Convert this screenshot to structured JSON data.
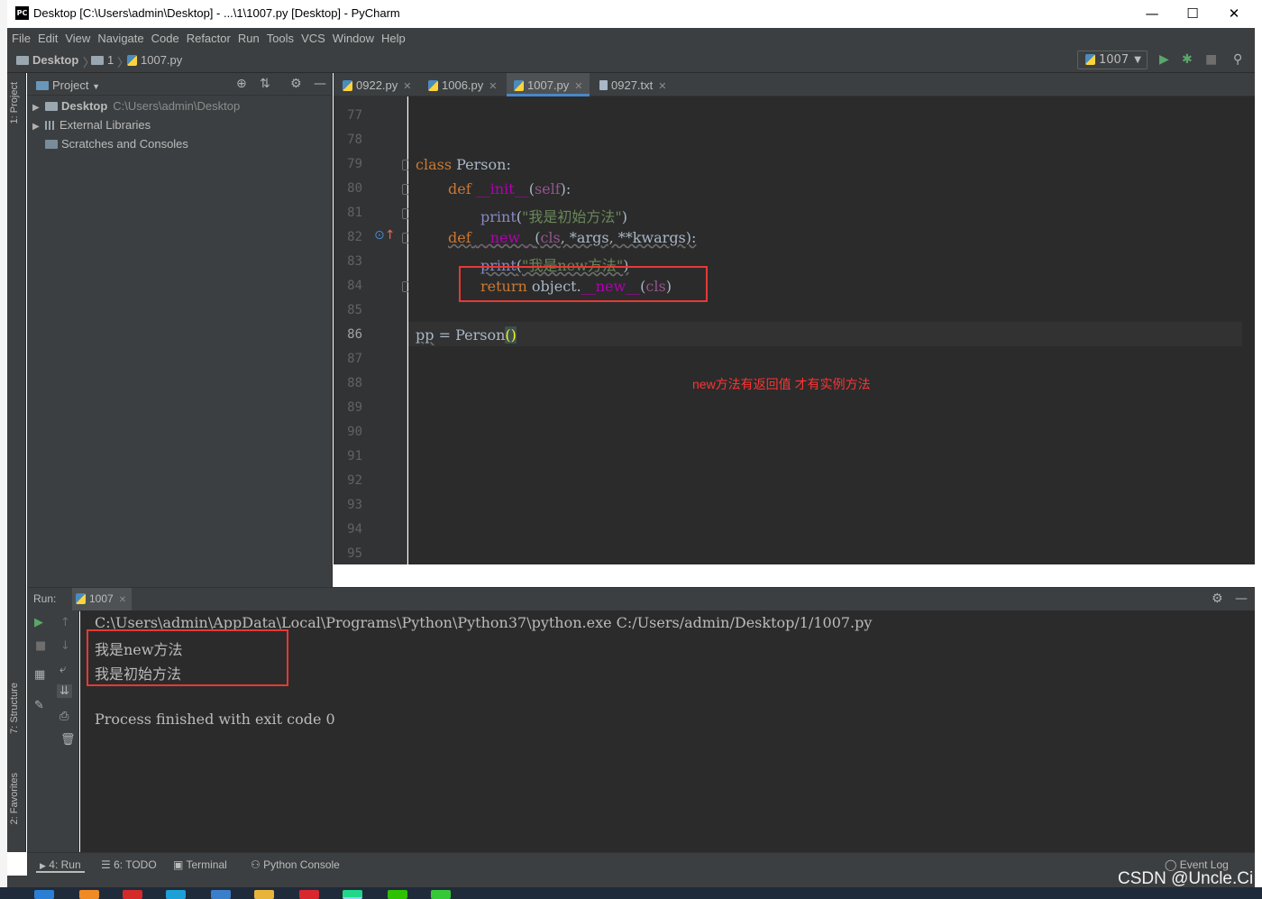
{
  "window": {
    "title": "Desktop [C:\\Users\\admin\\Desktop] - ...\\1\\1007.py [Desktop] - PyCharm",
    "logo": "PC",
    "controls": {
      "minimize": "—",
      "maximize": "☐",
      "close": "✕"
    }
  },
  "menu": [
    "File",
    "Edit",
    "View",
    "Navigate",
    "Code",
    "Refactor",
    "Run",
    "Tools",
    "VCS",
    "Window",
    "Help"
  ],
  "breadcrumb": {
    "root": "Desktop",
    "folder": "1",
    "file": "1007.py"
  },
  "run_config": "1007",
  "left_strip": {
    "project": "1: Project",
    "structure": "7: Structure",
    "favorites": "2: Favorites"
  },
  "project": {
    "title": "Project",
    "tree": [
      {
        "label": "Desktop",
        "path": "C:\\Users\\admin\\Desktop"
      },
      {
        "label": "External Libraries"
      },
      {
        "label": "Scratches and Consoles"
      }
    ]
  },
  "tabs": [
    {
      "label": "0922.py",
      "type": "py",
      "active": false
    },
    {
      "label": "1006.py",
      "type": "py",
      "active": false
    },
    {
      "label": "1007.py",
      "type": "py",
      "active": true
    },
    {
      "label": "0927.txt",
      "type": "txt",
      "active": false
    }
  ],
  "editor": {
    "line_numbers": [
      "77",
      "78",
      "79",
      "80",
      "81",
      "82",
      "83",
      "84",
      "85",
      "86",
      "87",
      "88",
      "89",
      "90",
      "91",
      "92",
      "93",
      "94",
      "95"
    ],
    "current_line": "86",
    "code": {
      "l79_kw": "class",
      "l79_rest": " Person:",
      "l80_kw": "def",
      "l80_fn": "__init__",
      "l80_open": "(",
      "l80_self": "self",
      "l80_close": "):",
      "l81_print": "print",
      "l81_open": "(",
      "l81_str": "\"我是初始方法\"",
      "l81_close": ")",
      "l82_kw": "def",
      "l82_fn": "__new__",
      "l82_open": "(",
      "l82_cls": "cls",
      "l82_rest": ", *args, **kwargs):",
      "l83_print": "print",
      "l83_open": "(",
      "l83_str": "\"我是new方法\"",
      "l83_close": ")",
      "l84_kw": "return",
      "l84_obj": " object.",
      "l84_fn": "__new__",
      "l84_open": "(",
      "l84_cls": "cls",
      "l84_close": ")",
      "l86_var": "pp",
      "l86_rest": " = Person",
      "l86_paren": "()"
    },
    "annotation": "new方法有返回值  才有实例方法"
  },
  "run_panel": {
    "label": "Run:",
    "tab": "1007",
    "output": [
      "C:\\Users\\admin\\AppData\\Local\\Programs\\Python\\Python37\\python.exe C:/Users/admin/Desktop/1/1007.py",
      "我是new方法",
      "我是初始方法",
      "",
      "Process finished with exit code 0"
    ]
  },
  "bottom_tabs": [
    "4: Run",
    "6: TODO",
    "Terminal",
    "Python Console"
  ],
  "event_log": "Event Log",
  "watermark": "CSDN @Uncle.Ci",
  "colors": {
    "accent": "#4a88c7",
    "highlight_box": "#e53935",
    "annotation": "#ff3333"
  }
}
